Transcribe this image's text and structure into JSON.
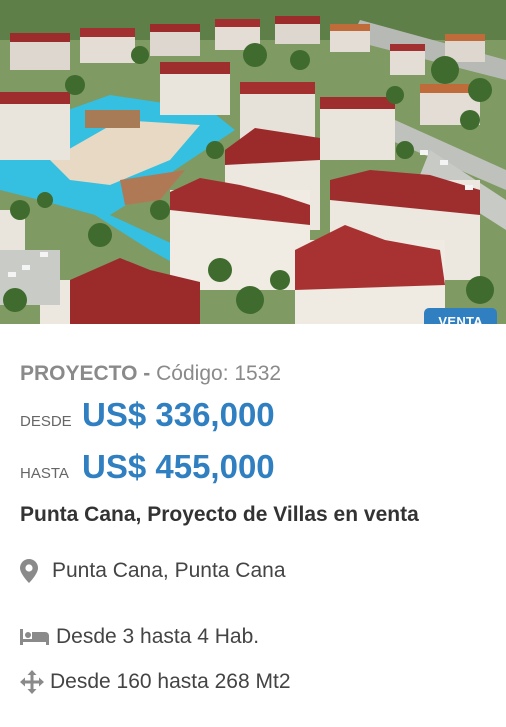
{
  "listing": {
    "badge": "VENTA",
    "type": "PROYECTO",
    "separator": " - ",
    "code_label": "Código: 1532",
    "price_from_label": "DESDE",
    "price_from": "US$ 336,000",
    "price_to_label": "HASTA",
    "price_to": "US$ 455,000",
    "title": "Punta Cana, Proyecto de Villas en venta",
    "location": "Punta Cana, Punta Cana",
    "rooms": "Desde 3 hasta 4 Hab.",
    "area": "Desde 160 hasta 268 Mt2"
  },
  "icons": {
    "location": "map-marker-icon",
    "rooms": "bed-icon",
    "area": "arrows-move-icon"
  },
  "colors": {
    "accent": "#2f7fc1",
    "badge_bg": "#2f7fc1",
    "muted": "#8a8a8a"
  }
}
